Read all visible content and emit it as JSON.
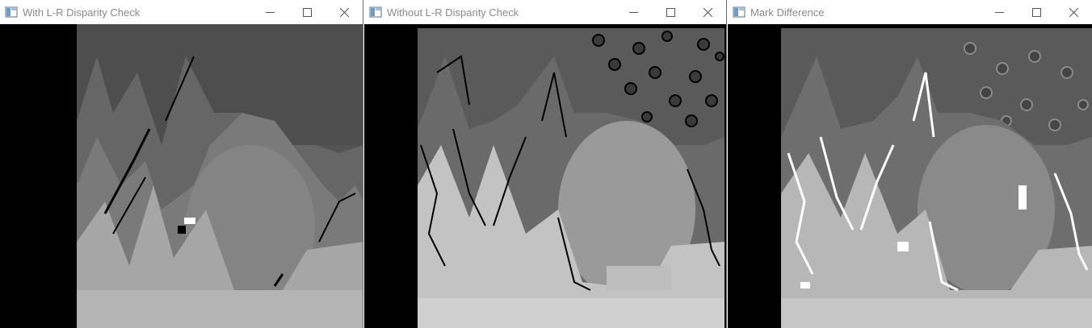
{
  "windows": [
    {
      "title": "With L-R Disparity Check",
      "icon": "app-window-icon",
      "controls": [
        "minimize-icon",
        "maximize-icon",
        "close-icon"
      ]
    },
    {
      "title": "Without L-R Disparity Check",
      "icon": "app-window-icon",
      "controls": [
        "minimize-icon",
        "maximize-icon",
        "close-icon"
      ]
    },
    {
      "title": "Mark Difference",
      "icon": "app-window-icon",
      "controls": [
        "minimize-icon",
        "maximize-icon",
        "close-icon"
      ]
    }
  ],
  "colors": {
    "sky": "#545454",
    "mid_gray": "#6e6e6e",
    "light_gray": "#9a9a9a",
    "ground": "#b4b4b4",
    "noise_dark": "#000000",
    "diff_mark": "#ffffff"
  }
}
